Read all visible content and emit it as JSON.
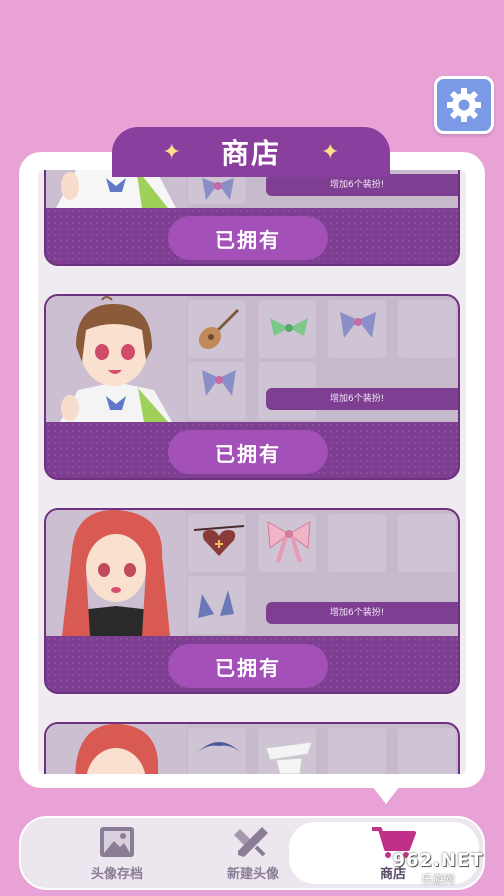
{
  "header": {
    "title": "商店",
    "sparkle_left": "✦",
    "sparkle_right": "✦"
  },
  "shop": {
    "cards": [
      {
        "banner": "增加6个装扮!",
        "button": "已拥有"
      },
      {
        "banner": "增加6个装扮!",
        "button": "已拥有"
      },
      {
        "banner": "增加6个装扮!",
        "button": "已拥有"
      },
      {
        "banner": "",
        "button": ""
      }
    ]
  },
  "nav": {
    "items": [
      {
        "label": "头像存档",
        "icon": "image-icon"
      },
      {
        "label": "新建头像",
        "icon": "edit-icon"
      },
      {
        "label": "商店",
        "icon": "shopping-cart-icon"
      }
    ]
  },
  "watermark": {
    "main": "962.NET",
    "sub": "乐游网"
  },
  "colors": {
    "background": "#e8a2d6",
    "accent": "#8a3f9e",
    "button": "#a350b8",
    "settings": "#7a9ae6"
  }
}
